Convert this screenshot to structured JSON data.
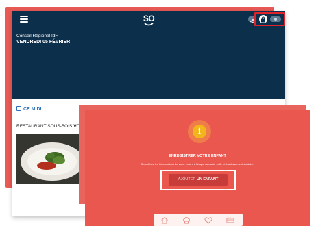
{
  "header": {
    "logo_text": "SO",
    "organization": "Conseil Régional IdF",
    "date": "VENDREDI 05 FÉVRIER",
    "icons": [
      "menu-icon",
      "share-icon",
      "bag-icon",
      "toggle-icon"
    ]
  },
  "section": {
    "tab_label": "CE MIDI",
    "restaurant_prefix": "RESTAURANT SOUS-BOIS ",
    "restaurant_suffix": "VO"
  },
  "modal": {
    "title": "ENREGISTRER VOTRE ENFANT",
    "text": "Complétez les informations de votre enfant à l'étape suivante : ville et établissement scolaire.",
    "button_prefix": "AJOUTER ",
    "button_strong": "UN ENFANT",
    "icon": "info-icon"
  },
  "bottom_nav": {
    "icons": [
      "home-icon",
      "chef-hat-icon",
      "heart-icon",
      "card-icon"
    ]
  },
  "colors": {
    "header_bg": "#0c2f4b",
    "coral": "#e9574f",
    "button": "#c73b38",
    "highlight": "#e0222a",
    "accent_blue": "#2f72b8",
    "info_yellow": "#f4b41c"
  }
}
